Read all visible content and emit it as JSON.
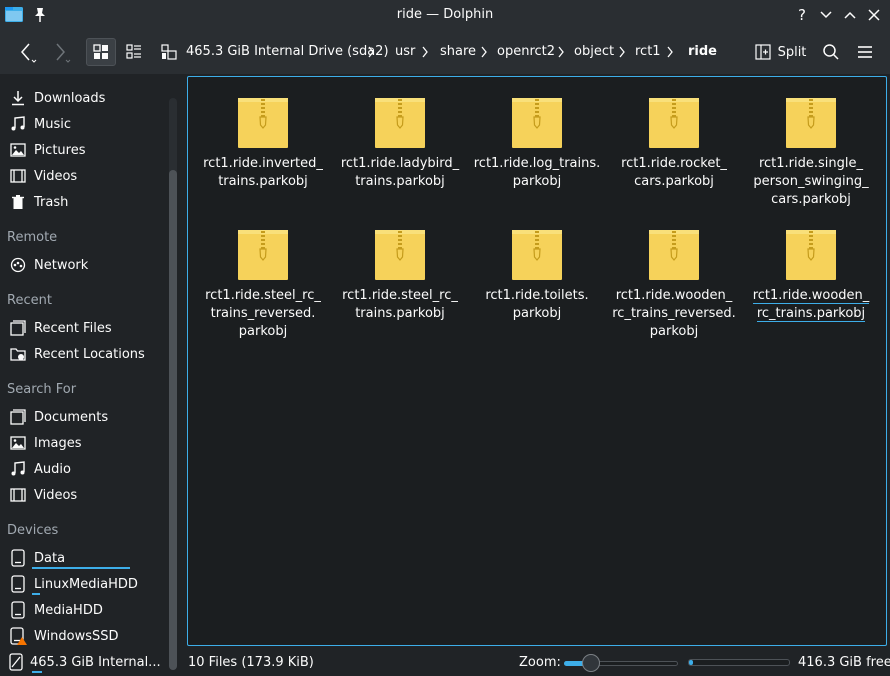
{
  "window": {
    "title": "ride — Dolphin"
  },
  "toolbar": {
    "split_label": "Split",
    "breadcrumbs": [
      "465.3 GiB Internal Drive (sda2)",
      "usr",
      "share",
      "openrct2",
      "object",
      "rct1",
      "ride"
    ]
  },
  "sidebar": {
    "places": [
      {
        "label": "Downloads",
        "icon": "download-icon"
      },
      {
        "label": "Music",
        "icon": "music-icon"
      },
      {
        "label": "Pictures",
        "icon": "pictures-icon"
      },
      {
        "label": "Videos",
        "icon": "videos-icon"
      },
      {
        "label": "Trash",
        "icon": "trash-icon"
      }
    ],
    "remote_heading": "Remote",
    "remote": [
      {
        "label": "Network",
        "icon": "network-icon"
      }
    ],
    "recent_heading": "Recent",
    "recent": [
      {
        "label": "Recent Files",
        "icon": "recent-files-icon"
      },
      {
        "label": "Recent Locations",
        "icon": "recent-locations-icon"
      }
    ],
    "search_heading": "Search For",
    "search": [
      {
        "label": "Documents",
        "icon": "documents-icon"
      },
      {
        "label": "Images",
        "icon": "images-icon"
      },
      {
        "label": "Audio",
        "icon": "audio-icon"
      },
      {
        "label": "Videos",
        "icon": "videos-icon"
      }
    ],
    "devices_heading": "Devices",
    "devices": [
      {
        "label": "Data",
        "icon": "drive-icon"
      },
      {
        "label": "LinuxMediaHDD",
        "icon": "drive-icon"
      },
      {
        "label": "MediaHDD",
        "icon": "drive-icon"
      },
      {
        "label": "WindowsSSD",
        "icon": "drive-warning-icon"
      },
      {
        "label": "465.3 GiB Internal...",
        "icon": "drive-icon"
      }
    ]
  },
  "files": [
    {
      "name": "rct1.ride.inverted_\ntrains.parkobj"
    },
    {
      "name": "rct1.ride.ladybird_\ntrains.parkobj"
    },
    {
      "name": "rct1.ride.log_trains.\nparkobj"
    },
    {
      "name": "rct1.ride.rocket_\ncars.parkobj"
    },
    {
      "name": "rct1.ride.single_\nperson_swinging_\ncars.parkobj"
    },
    {
      "name": "rct1.ride.steel_rc_\ntrains_reversed.\nparkobj"
    },
    {
      "name": "rct1.ride.steel_rc_\ntrains.parkobj"
    },
    {
      "name": "rct1.ride.toilets.\nparkobj"
    },
    {
      "name": "rct1.ride.wooden_\nrc_trains_reversed.\nparkobj"
    },
    {
      "name": "rct1.ride.wooden_\nrc_trains.parkobj"
    }
  ],
  "status": {
    "file_count": "10 Files (173.9 KiB)",
    "zoom_label": "Zoom:",
    "zoom_level": 0.2,
    "free_space": "416.3 GiB free",
    "used_fraction": 0.03
  },
  "colors": {
    "accent": "#3daee9",
    "folder": "#f6d25a"
  }
}
